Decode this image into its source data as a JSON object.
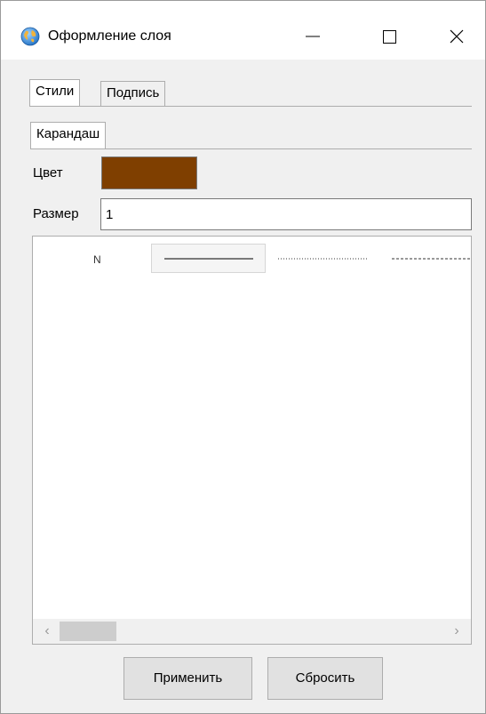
{
  "window": {
    "title": "Оформление слоя",
    "icon": "globe-icon"
  },
  "tabs": [
    {
      "label": "Стили",
      "active": true
    },
    {
      "label": "Подпись",
      "active": false
    }
  ],
  "subtabs": [
    {
      "label": "Карандаш",
      "active": true
    }
  ],
  "fields": {
    "color_label": "Цвет",
    "color_value": "#7f3f00",
    "size_label": "Размер",
    "size_value": "1"
  },
  "style_list": {
    "row_label": "N",
    "styles": [
      "solid",
      "dotted",
      "dashed"
    ],
    "selected": "solid"
  },
  "buttons": {
    "apply": "Применить",
    "reset": "Сбросить"
  }
}
